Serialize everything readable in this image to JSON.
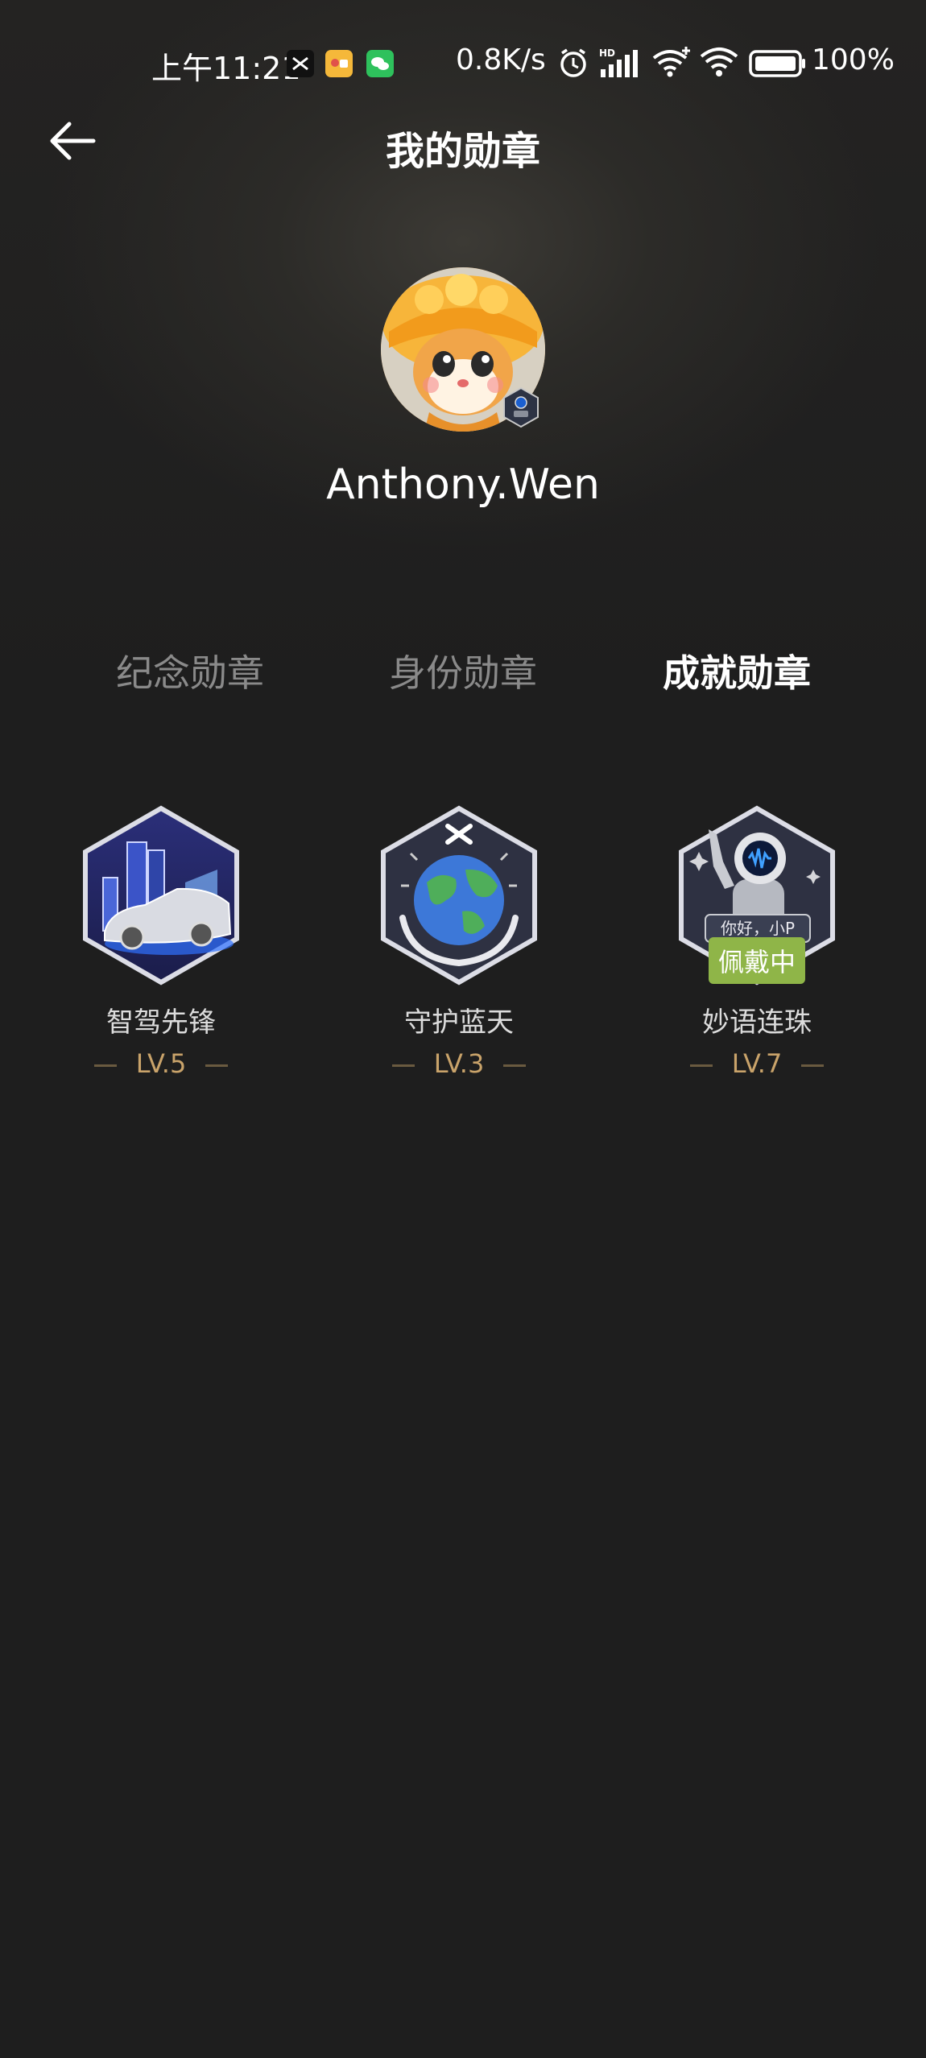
{
  "status_bar": {
    "time": "上午11:21",
    "network_speed": "0.8K/s",
    "battery": "100%",
    "icons": [
      "close-x-icon",
      "notification-app-icon",
      "wechat-icon",
      "alarm-icon",
      "hd-signal-icon",
      "wifi-plus-icon",
      "wifi-icon",
      "battery-icon"
    ]
  },
  "header": {
    "title": "我的勋章",
    "back_icon": "arrow-left-icon"
  },
  "profile": {
    "username": "Anthony.Wen"
  },
  "tabs": [
    {
      "label": "纪念勋章",
      "active": false
    },
    {
      "label": "身份勋章",
      "active": false
    },
    {
      "label": "成就勋章",
      "active": true
    }
  ],
  "badges": [
    {
      "name": "智驾先锋",
      "level": "LV.5",
      "icon": "car-city-badge-icon"
    },
    {
      "name": "守护蓝天",
      "level": "LV.3",
      "icon": "earth-hands-badge-icon"
    },
    {
      "name": "妙语连珠",
      "level": "LV.7",
      "icon": "astronaut-voice-badge-icon",
      "badge_text": "你好，小P",
      "tag": "佩戴中"
    }
  ],
  "colors": {
    "background": "#1e1e1e",
    "level_gold": "#c9a36a",
    "wearing_green": "#8fb548"
  }
}
